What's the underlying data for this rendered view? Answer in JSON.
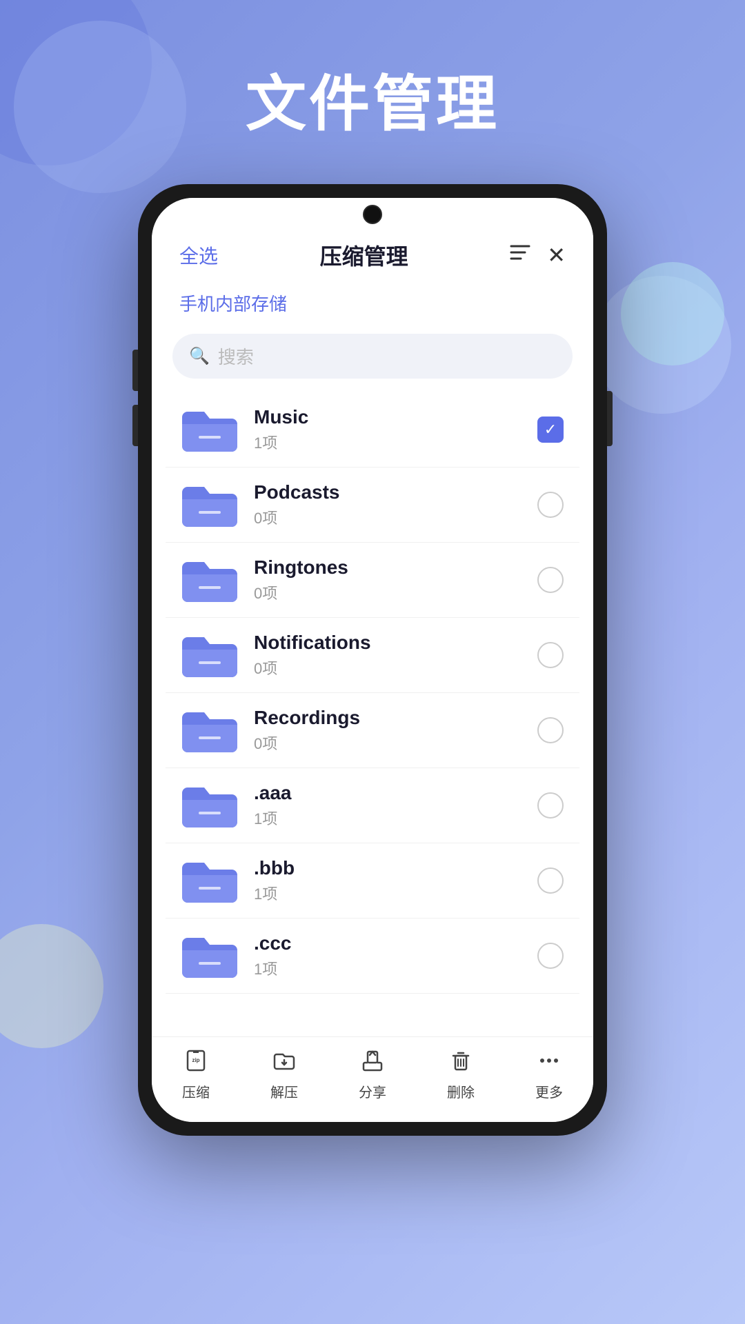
{
  "page": {
    "title": "文件管理",
    "background_color": "#8a9fe8"
  },
  "header": {
    "select_all": "全选",
    "title": "压缩管理",
    "sort_icon": "sort-icon",
    "close_icon": "close-icon"
  },
  "storage": {
    "label": "手机内部存储"
  },
  "search": {
    "placeholder": "搜索"
  },
  "folders": [
    {
      "name": "Music",
      "count": "1项",
      "checked": true
    },
    {
      "name": "Podcasts",
      "count": "0项",
      "checked": false
    },
    {
      "name": "Ringtones",
      "count": "0项",
      "checked": false
    },
    {
      "name": "Notifications",
      "count": "0项",
      "checked": false
    },
    {
      "name": "Recordings",
      "count": "0项",
      "checked": false
    },
    {
      "name": ".aaa",
      "count": "1项",
      "checked": false
    },
    {
      "name": ".bbb",
      "count": "1项",
      "checked": false
    },
    {
      "name": ".ccc",
      "count": "1项",
      "checked": false
    }
  ],
  "toolbar": {
    "items": [
      {
        "label": "压缩",
        "icon": "compress-icon"
      },
      {
        "label": "解压",
        "icon": "decompress-icon"
      },
      {
        "label": "分享",
        "icon": "share-icon"
      },
      {
        "label": "删除",
        "icon": "delete-icon"
      },
      {
        "label": "更多",
        "icon": "more-icon"
      }
    ]
  }
}
